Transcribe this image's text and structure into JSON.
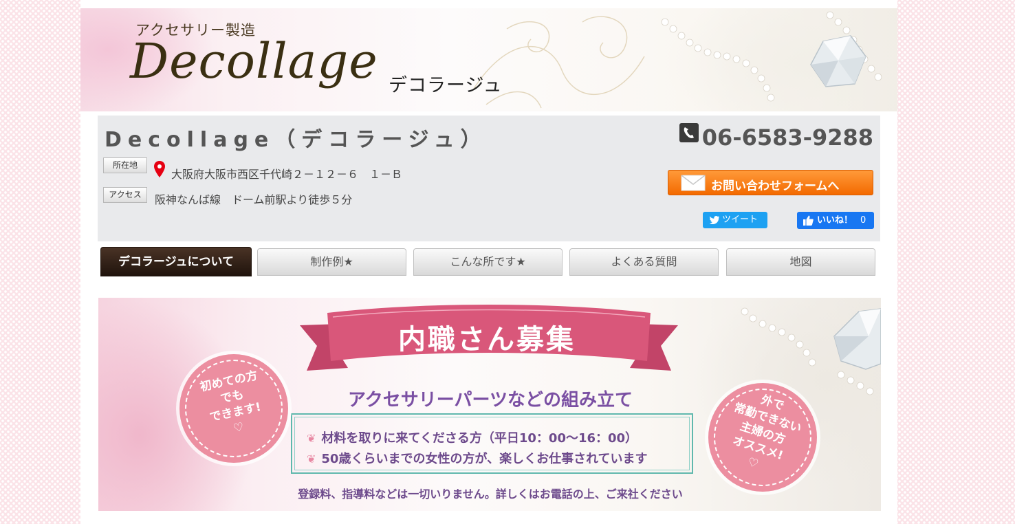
{
  "header": {
    "subtitle": "アクセサリー製造",
    "logo": "Decollage",
    "logo_kana": "デコラージュ"
  },
  "info": {
    "shop_name": "Decollage（デコラージュ）",
    "address_label": "所在地",
    "address": "大阪府大阪市西区千代崎２－１２－６　１－Ｂ",
    "access_label": "アクセス",
    "access": "阪神なんば線　ドーム前駅より徒歩５分",
    "phone": "06-6583-9288",
    "contact_button": "お問い合わせフォームへ",
    "tweet_button": "ツイート",
    "like_button": "いいね！",
    "like_count": "0"
  },
  "nav": {
    "tabs": [
      {
        "label": "デコラージュについて",
        "active": true
      },
      {
        "label": "制作例★",
        "active": false
      },
      {
        "label": "こんな所です★",
        "active": false
      },
      {
        "label": "よくある質問",
        "active": false
      },
      {
        "label": "地図",
        "active": false
      }
    ]
  },
  "recruit": {
    "title": "内職さん募集",
    "subtitle": "アクセサリーパーツなどの組み立て",
    "bullets": [
      "材料を取りに来てくださる方（平日10：00～16：00）",
      "50歳くらいまでの女性の方が、楽しくお仕事されています"
    ],
    "note": "登録料、指導料などは一切いりません。詳しくはお電話の上、ご来社ください",
    "badge_left": [
      "初めての方",
      "でも",
      "できます!"
    ],
    "badge_right": [
      "外で",
      "常勤できない",
      "主婦の方",
      "オススメ!"
    ]
  },
  "colors": {
    "background_pink": "#fbe3e8",
    "contact_orange": "#f36a00",
    "twitter_blue": "#1da1f2",
    "facebook_blue": "#1877f2",
    "ribbon_pink": "#d9577a",
    "purple_text": "#7a4fa3",
    "active_tab": "#2e1d13"
  }
}
